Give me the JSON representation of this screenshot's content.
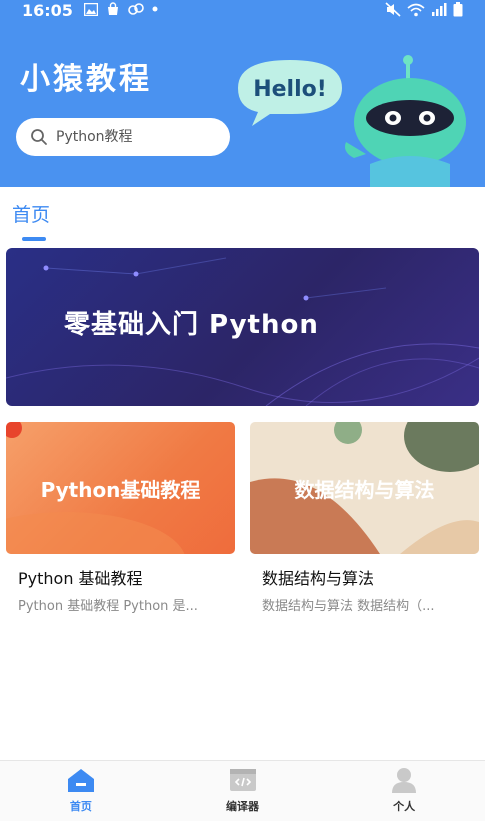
{
  "status_bar": {
    "time": "16:05",
    "left_icons": [
      "image-icon",
      "bag-icon",
      "link-icon",
      "dot-icon"
    ],
    "right_icons": [
      "mute-icon",
      "wifi-icon",
      "signal-icon",
      "battery-icon"
    ]
  },
  "header": {
    "app_title": "小猿教程",
    "search_placeholder": "Python教程",
    "robot_bubble": "Hello!",
    "background_color": "#4a92f0"
  },
  "tabs": [
    {
      "label": "首页",
      "active": true
    }
  ],
  "banner": {
    "text": "零基础入门 Python"
  },
  "cards": [
    {
      "image_text": "Python基础教程",
      "title": "Python 基础教程",
      "subtitle": "Python 基础教程   Python 是..."
    },
    {
      "image_text": "数据结构与算法",
      "title": "数据结构与算法",
      "subtitle": "数据结构与算法   数据结构（..."
    }
  ],
  "bottom_nav": [
    {
      "label": "首页",
      "icon": "home-icon",
      "active": true
    },
    {
      "label": "编译器",
      "icon": "code-editor-icon",
      "active": false
    },
    {
      "label": "个人",
      "icon": "person-icon",
      "active": false
    }
  ],
  "accent_color": "#3d8af2"
}
